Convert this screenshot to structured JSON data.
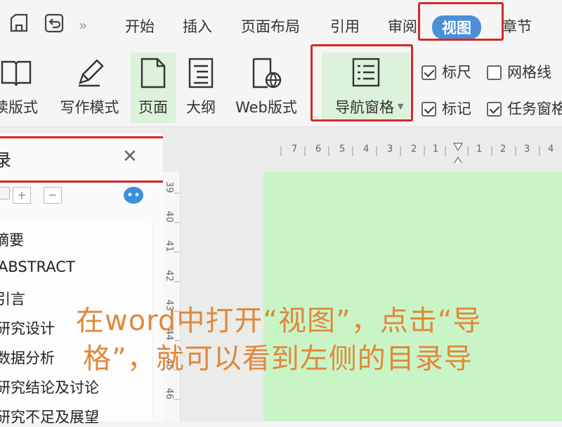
{
  "menu_tabs": {
    "start": "开始",
    "insert": "插入",
    "page_layout": "页面布局",
    "references": "引用",
    "review": "审阅",
    "view": "视图",
    "chapter": "章节"
  },
  "ribbon": {
    "read_mode": "读版式",
    "write_mode": "写作模式",
    "page": "页面",
    "outline": "大纲",
    "web_layout": "Web版式",
    "nav_pane": "导航窗格",
    "ruler": "标尺",
    "gridlines": "网格线",
    "marks": "标记",
    "task_pane": "任务窗格"
  },
  "checkboxes": {
    "ruler_checked": true,
    "gridlines_checked": false,
    "marks_checked": true,
    "task_pane_checked": true
  },
  "nav_pane": {
    "header": "录",
    "items": [
      "摘要",
      "ABSTRACT",
      "引言",
      "研究设计",
      "数据分析",
      "研究结论及讨论",
      "研究不足及展望"
    ]
  },
  "ruler": {
    "horizontal": [
      "7",
      "6",
      "5",
      "4",
      "3",
      "2",
      "1",
      "1",
      "2",
      "3",
      "4"
    ],
    "vertical": [
      "39",
      "40",
      "41",
      "42",
      "43",
      "44",
      "45",
      "46"
    ]
  },
  "caption": {
    "line1": "在word中打开“视图”，点击“导",
    "line2": "格”，就可以看到左侧的目录导"
  },
  "colors": {
    "highlight_red": "#d62828",
    "view_tab_pill": "#4a8fd8",
    "page_green": "#c9f5c6",
    "caption_orange": "#e2873b"
  }
}
